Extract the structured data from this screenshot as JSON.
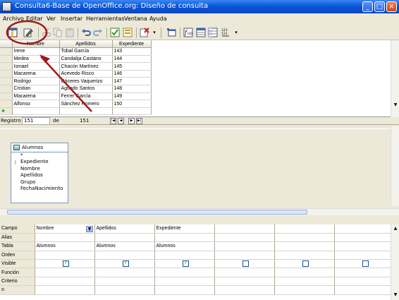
{
  "window": {
    "title": "Consulta6-Base de OpenOffice.org: Diseño de consulta",
    "controls": [
      "_",
      "□",
      "×"
    ]
  },
  "menu": [
    "Archivo",
    "Editar",
    "Ver",
    "Insertar",
    "Herramientas",
    "Ventana",
    "Ayuda"
  ],
  "grid": {
    "columns": [
      "Nombre",
      "Apellidos",
      "Expediente"
    ],
    "rows": [
      [
        "Irene",
        "Tobal García",
        "143"
      ],
      [
        "Medea",
        "Candalija Castano",
        "144"
      ],
      [
        "Ismael",
        "Chacón Martínez",
        "145"
      ],
      [
        "Macarena",
        "Acevedo Risco",
        "146"
      ],
      [
        "Rodrigo",
        "Cáceres Vaquerizo",
        "147"
      ],
      [
        "Cristian",
        "Aguado Santos",
        "148"
      ],
      [
        "Macarena",
        "Ferrer García",
        "149"
      ],
      [
        "Alfonso",
        "Sánchez Romero",
        "150"
      ]
    ]
  },
  "navigator": {
    "label": "Registro",
    "current": "151",
    "of_label": "de",
    "total": "151"
  },
  "design": {
    "table_name": "Alumnos",
    "fields": [
      "*",
      "Expediente",
      "Nombre",
      "Apellidos",
      "Grupo",
      "FechaNacimiento"
    ],
    "key_field_index": 1
  },
  "criteria": {
    "row_labels": [
      "Campo",
      "Alias",
      "Tabla",
      "Orden",
      "Visible",
      "Función",
      "Criterio",
      "o"
    ],
    "columns": [
      {
        "campo": "Nombre",
        "tabla": "Alumnos",
        "visible": true
      },
      {
        "campo": "Apellidos",
        "tabla": "Alumnos",
        "visible": true
      },
      {
        "campo": "Expediente",
        "tabla": "Alumnos",
        "visible": true
      },
      {
        "campo": "",
        "tabla": "",
        "visible": false
      },
      {
        "campo": "",
        "tabla": "",
        "visible": false
      },
      {
        "campo": "",
        "tabla": "",
        "visible": false
      }
    ]
  },
  "toolbar_icons": [
    "switch-design-view-icon",
    "edit-pencil-icon",
    "cut-icon",
    "copy-icon",
    "paste-icon",
    "undo-icon",
    "redo-icon",
    "run-query-icon",
    "clear-query-icon",
    "delete-icon",
    "add-tables-icon",
    "functions-icon",
    "table-name-icon",
    "alias-icon",
    "distinct-values-icon"
  ],
  "annotation_color": "#a01a1a"
}
